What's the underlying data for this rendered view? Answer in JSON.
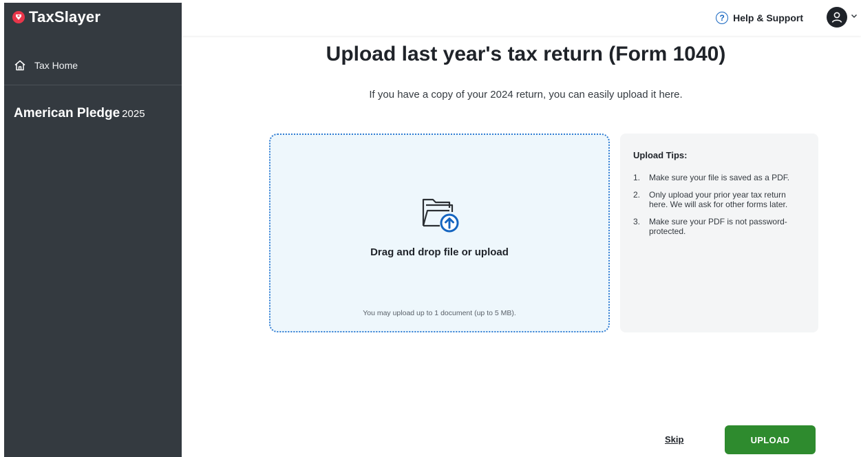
{
  "brand": {
    "name": "TaxSlayer",
    "accent_color": "#e8364a",
    "sidebar_bg": "#343a40"
  },
  "sidebar": {
    "home_item": {
      "label": "Tax Home",
      "icon": "home-icon"
    },
    "return_name": "American Pledge",
    "return_year": "2025"
  },
  "header": {
    "help_label": "Help & Support",
    "help_icon": "question-circle-icon",
    "account_icon": "user-avatar-icon",
    "account_menu_icon": "chevron-down-icon"
  },
  "main": {
    "title": "Upload last year's tax return (Form 1040)",
    "subtitle": "If you have a copy of your 2024 return, you can easily upload it here.",
    "dropzone": {
      "icon": "folder-upload-icon",
      "label": "Drag and drop file or upload",
      "note": "You may upload up to 1 document (up to 5 MB)."
    },
    "tips": {
      "title": "Upload Tips:",
      "items": [
        {
          "num": "1.",
          "text": "Make sure your file is saved as a PDF."
        },
        {
          "num": "2.",
          "text": "Only upload your prior year tax return here. We will ask for other forms later."
        },
        {
          "num": "3.",
          "text": "Make sure your PDF is not password-protected."
        }
      ]
    }
  },
  "footer": {
    "skip_label": "Skip",
    "upload_label": "UPLOAD",
    "upload_color": "#2e8b2e"
  }
}
